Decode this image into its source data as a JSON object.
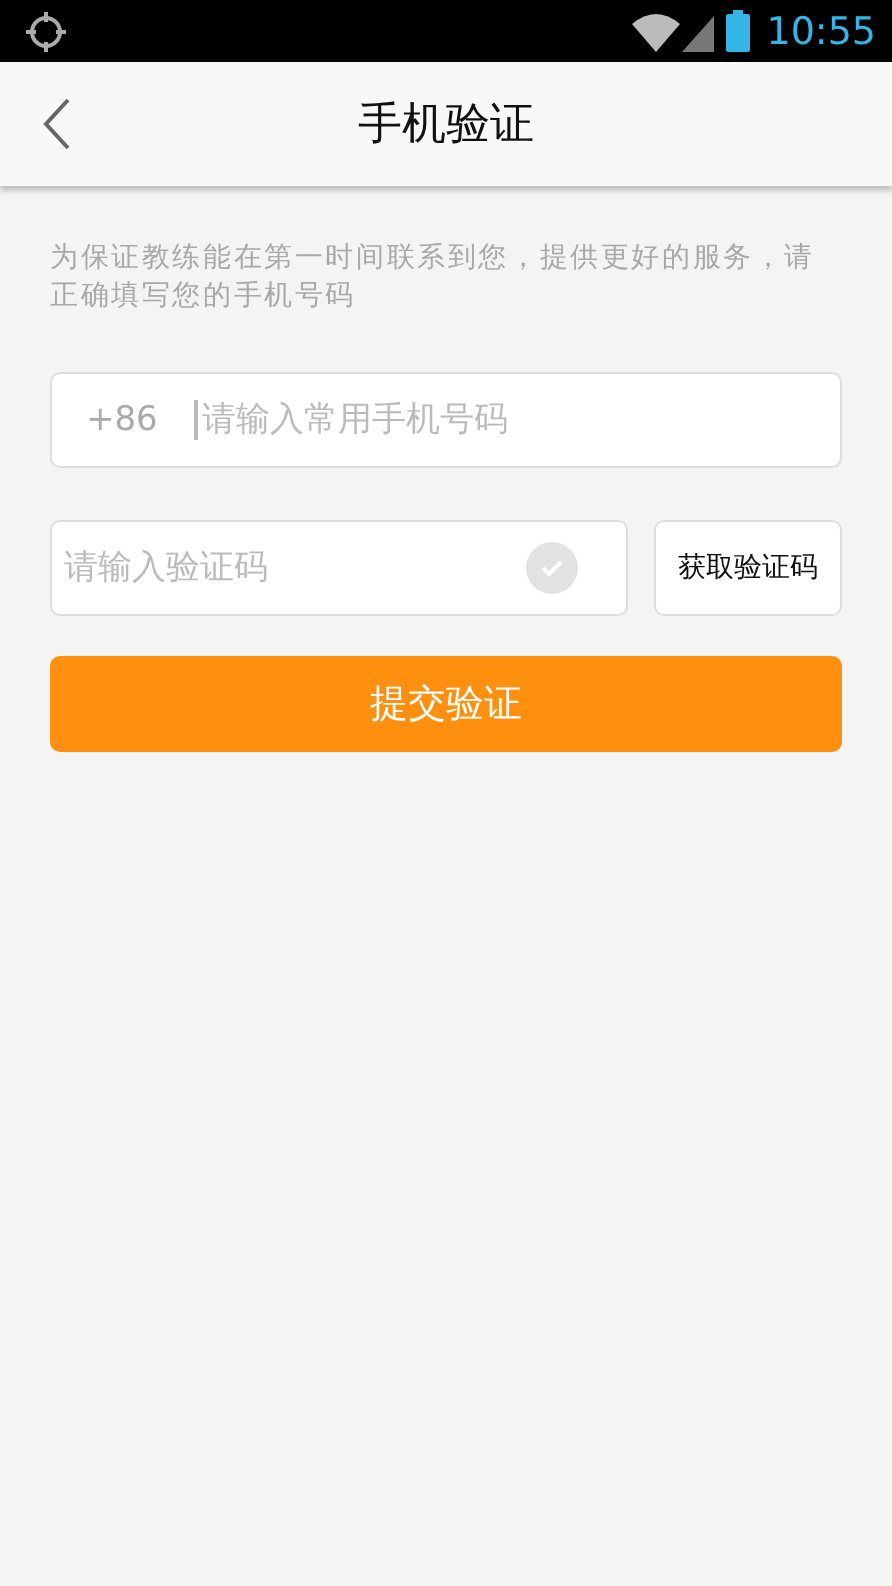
{
  "status_bar": {
    "time": "10:55"
  },
  "header": {
    "title": "手机验证"
  },
  "hint": "为保证教练能在第一时间联系到您，提供更好的服务，请正确填写您的手机号码",
  "phone_field": {
    "prefix": "+86",
    "placeholder": "请输入常用手机号码"
  },
  "code_field": {
    "placeholder": "请输入验证码",
    "verified": false
  },
  "get_code_button": "获取验证码",
  "submit_button": "提交验证"
}
